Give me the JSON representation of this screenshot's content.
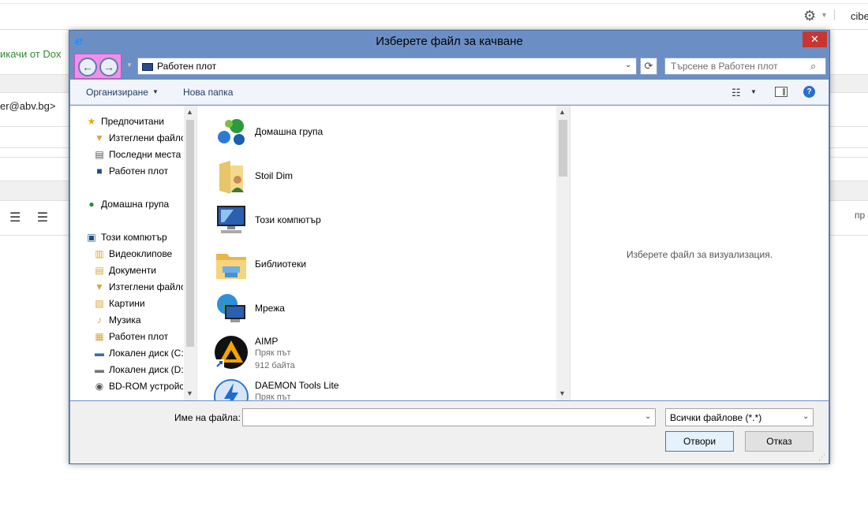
{
  "background_page": {
    "user_text": "cibe",
    "dox_link": "икачи от Dox",
    "email_text": "er@abv.bg>",
    "right_text": "пр",
    "format_icons": "☰ ☰"
  },
  "dialog": {
    "title": "Изберете файл за качване",
    "close_label": "✕",
    "address_value": "Работен плот",
    "search_placeholder": "Търсене в Работен плот",
    "toolbar": {
      "organize_label": "Организиране",
      "new_folder_label": "Нова папка"
    },
    "nav_pane": {
      "items": [
        {
          "label": "Предпочитани",
          "icon": "star-icon"
        },
        {
          "label": "Изтеглени файлове",
          "icon": "downloads-folder-icon"
        },
        {
          "label": "Последни места",
          "icon": "recent-places-icon"
        },
        {
          "label": "Работен плот",
          "icon": "desktop-icon"
        },
        {
          "label": "Домашна група",
          "icon": "homegroup-icon"
        },
        {
          "label": "Този компютър",
          "icon": "computer-icon"
        },
        {
          "label": "Видеоклипове",
          "icon": "videos-folder-icon"
        },
        {
          "label": "Документи",
          "icon": "documents-folder-icon"
        },
        {
          "label": "Изтеглени файлове",
          "icon": "downloads-folder-icon"
        },
        {
          "label": "Картини",
          "icon": "pictures-folder-icon"
        },
        {
          "label": "Музика",
          "icon": "music-folder-icon"
        },
        {
          "label": "Работен плот",
          "icon": "desktop-folder-icon"
        },
        {
          "label": "Локален диск (C:)",
          "icon": "local-disk-icon"
        },
        {
          "label": "Локален диск (D:)",
          "icon": "local-disk-icon"
        },
        {
          "label": "BD-ROM устройство",
          "icon": "bd-rom-icon"
        }
      ]
    },
    "files": [
      {
        "name": "Домашна група",
        "sub1": "",
        "sub2": "",
        "icon": "homegroup-icon"
      },
      {
        "name": "Stoil Dim",
        "sub1": "",
        "sub2": "",
        "icon": "user-folder-icon"
      },
      {
        "name": "Този компютър",
        "sub1": "",
        "sub2": "",
        "icon": "computer-icon"
      },
      {
        "name": "Библиотеки",
        "sub1": "",
        "sub2": "",
        "icon": "libraries-icon"
      },
      {
        "name": "Мрежа",
        "sub1": "",
        "sub2": "",
        "icon": "network-icon"
      },
      {
        "name": "AIMP",
        "sub1": "Пряк път",
        "sub2": "912 байта",
        "icon": "aimp-shortcut-icon"
      },
      {
        "name": "DAEMON Tools Lite",
        "sub1": "Пряк път",
        "sub2": "",
        "icon": "daemon-tools-shortcut-icon"
      }
    ],
    "preview_text": "Изберете файл за визуализация.",
    "filename_label": "Име на файла:",
    "filename_value": "",
    "filetype_value": "Всички файлове (*.*)",
    "open_label": "Отвори",
    "cancel_label": "Отказ"
  }
}
